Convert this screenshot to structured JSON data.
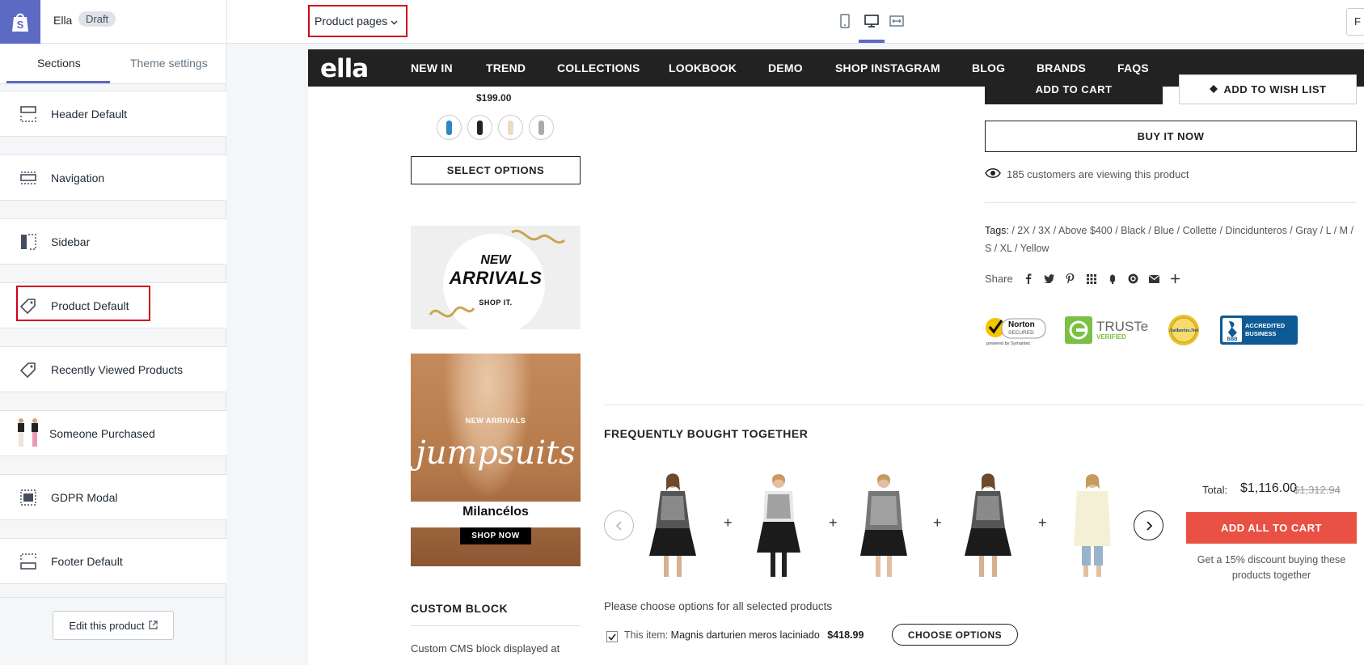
{
  "topbar": {
    "theme_name": "Ella",
    "status_badge": "Draft",
    "page_selector": "Product pages",
    "right_button": "F"
  },
  "sidebar": {
    "tabs": [
      {
        "label": "Sections",
        "active": true
      },
      {
        "label": "Theme settings",
        "active": false
      }
    ],
    "sections": [
      {
        "label": "Header Default",
        "icon": "header-layout-icon"
      },
      {
        "label": "Navigation",
        "icon": "navigation-layout-icon"
      },
      {
        "label": "Sidebar",
        "icon": "sidebar-layout-icon"
      },
      {
        "label": "Product Default",
        "icon": "tag-icon",
        "highlighted": true
      },
      {
        "label": "Recently Viewed Products",
        "icon": "tag-icon"
      },
      {
        "label": "Someone Purchased",
        "icon": "product-thumbnail"
      },
      {
        "label": "GDPR Modal",
        "icon": "modal-layout-icon"
      },
      {
        "label": "Footer Default",
        "icon": "footer-layout-icon"
      }
    ],
    "edit_button": "Edit this product"
  },
  "store": {
    "logo": "ella",
    "nav": [
      "NEW IN",
      "TREND",
      "COLLECTIONS",
      "LOOKBOOK",
      "DEMO",
      "SHOP INSTAGRAM",
      "BLOG",
      "BRANDS",
      "FAQS"
    ]
  },
  "left_column": {
    "price": "$199.00",
    "select_options": "SELECT OPTIONS",
    "banner1": {
      "line1": "NEW",
      "line2": "ARRIVALS",
      "line3": "SHOP IT."
    },
    "banner2": {
      "kicker": "NEW ARRIVALS",
      "script": "jumpsuits",
      "brand": "Milancélos",
      "cta": "SHOP NOW"
    },
    "custom_block_title": "CUSTOM BLOCK",
    "custom_block_text": "Custom CMS block displayed at"
  },
  "product": {
    "add_to_cart": "ADD TO CART",
    "add_to_wishlist": "ADD TO WISH LIST",
    "buy_now": "BUY IT NOW",
    "viewing": "185 customers are viewing this product",
    "tags_label": "Tags:",
    "tags_text": " / 2X / 3X / Above $400 / Black / Blue / Collette / Dincidunteros / Gray / L / M / S / XL / Yellow",
    "share_label": "Share",
    "trust_badges": {
      "norton": "Norton",
      "norton_sub": "SECURED",
      "norton_powered": "powered by Symantec",
      "truste": "TRUSTe",
      "truste_sub": "VERIFIED",
      "authorize": "Authorize.Net",
      "bbb_line1": "ACCREDITED",
      "bbb_line2": "BUSINESS",
      "bbb_logo": "BBB"
    }
  },
  "fbt": {
    "title": "FREQUENTLY BOUGHT TOGETHER",
    "total_label": "Total:",
    "total_price": "$1,116.00",
    "total_old": "$1,312.94",
    "add_all": "ADD ALL TO CART",
    "discount_note": "Get a 15% discount buying these products together",
    "choose_note": "Please choose options for all selected products",
    "this_item_label": "This item:",
    "this_item_name": "Magnis darturien meros laciniado",
    "this_item_price": "$418.99",
    "choose_options": "CHOOSE OPTIONS"
  }
}
